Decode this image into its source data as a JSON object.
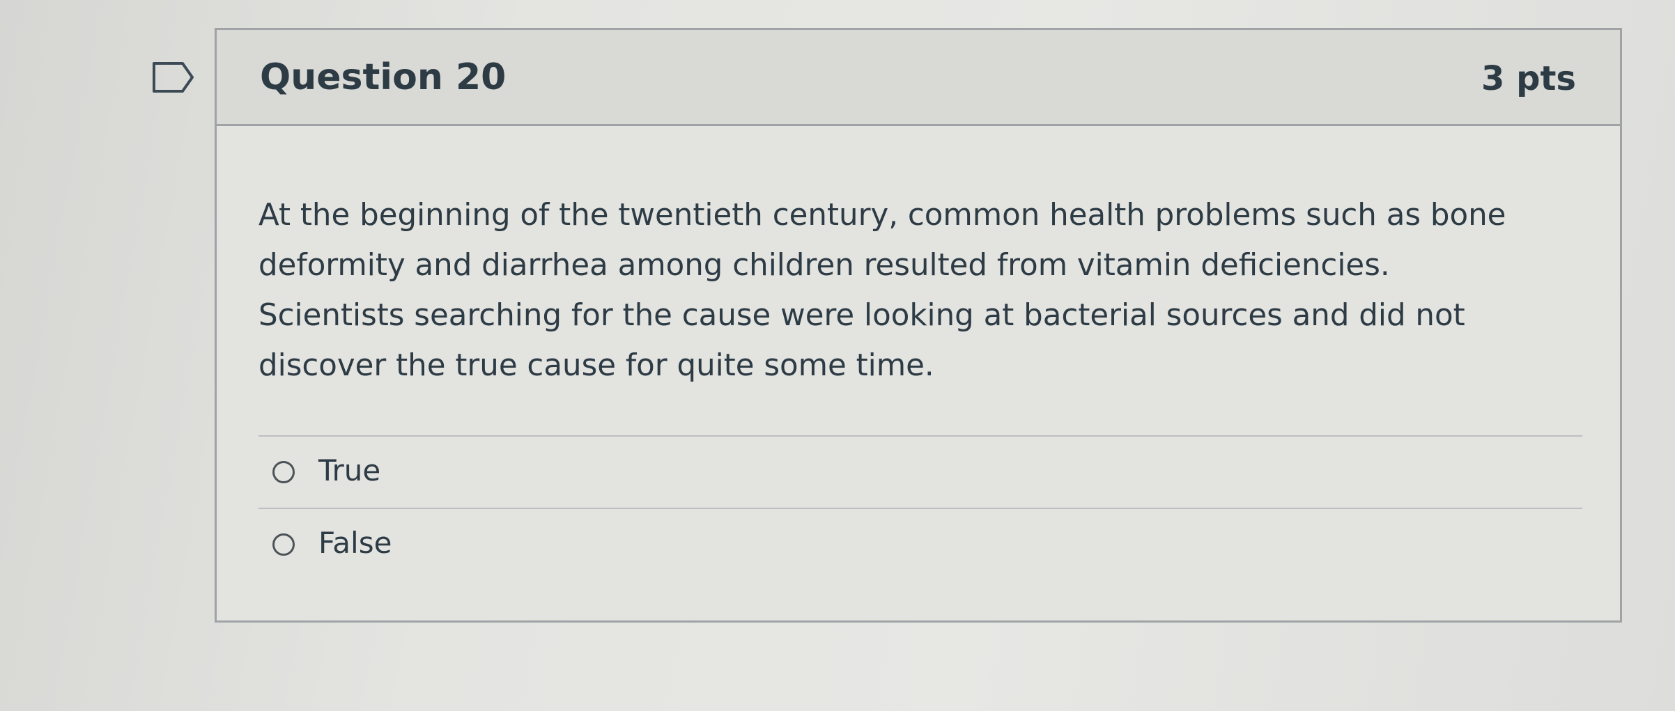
{
  "question": {
    "title": "Question 20",
    "points": "3 pts",
    "text": "At the beginning of the twentieth century, common health problems such as bone deformity and diarrhea among children resulted from vitamin deficiencies. Scientists searching for the cause were looking at bacterial sources and did not discover the true cause for quite some time."
  },
  "answers": [
    {
      "label": "True",
      "selected": false
    },
    {
      "label": "False",
      "selected": false
    }
  ],
  "icons": {
    "flag": "flag-question-icon",
    "radio": "radio-button-icon"
  },
  "colors": {
    "text": "#2d3b45",
    "border": "#9fa3a6",
    "header_bg": "#d9d9d6",
    "card_bg": "#e3e3e0"
  }
}
